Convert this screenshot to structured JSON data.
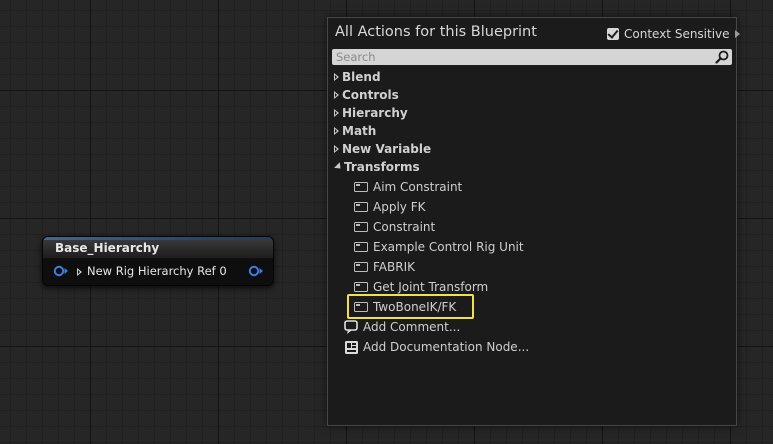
{
  "node": {
    "title": "Base_Hierarchy",
    "pin_label": "New Rig Hierarchy Ref 0"
  },
  "menu": {
    "title": "All Actions for this Blueprint",
    "context_sensitive_label": "Context Sensitive",
    "context_sensitive_checked": true,
    "search": {
      "placeholder": "Search",
      "value": ""
    },
    "categories": [
      {
        "label": "Blend",
        "expanded": false
      },
      {
        "label": "Controls",
        "expanded": false
      },
      {
        "label": "Hierarchy",
        "expanded": false
      },
      {
        "label": "Math",
        "expanded": false
      },
      {
        "label": "New Variable",
        "expanded": false
      },
      {
        "label": "Transforms",
        "expanded": true
      }
    ],
    "transform_actions": [
      {
        "label": "Aim Constraint"
      },
      {
        "label": "Apply FK"
      },
      {
        "label": "Constraint"
      },
      {
        "label": "Example Control Rig Unit"
      },
      {
        "label": "FABRIK"
      },
      {
        "label": "Get Joint Transform"
      },
      {
        "label": "TwoBoneIK/FK",
        "highlighted": true
      }
    ],
    "utilities": [
      {
        "label": "Add Comment...",
        "icon": "comment-icon"
      },
      {
        "label": "Add Documentation Node...",
        "icon": "documentation-icon"
      }
    ]
  },
  "colors": {
    "highlight": "#f2e04a",
    "exec_pin": "#3f7de0",
    "graph_background": "#262626",
    "menu_background": "#1b1b1b"
  }
}
